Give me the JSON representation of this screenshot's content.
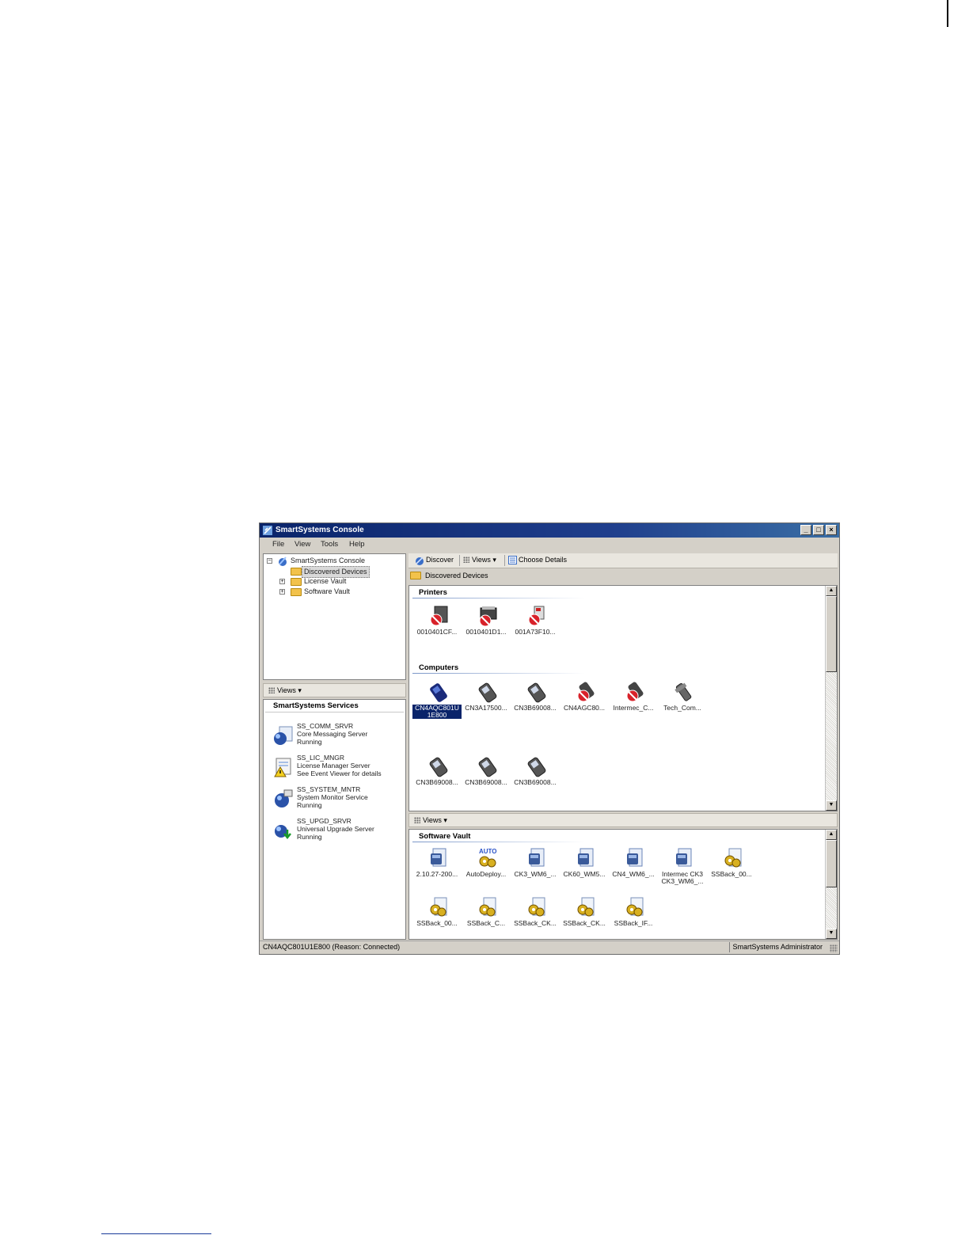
{
  "window": {
    "title": "SmartSystems Console",
    "minimize": "_",
    "maximize": "□",
    "close": "×"
  },
  "menu": {
    "file": "File",
    "view": "View",
    "tools": "Tools",
    "help": "Help"
  },
  "tree": {
    "root": "SmartSystems Console",
    "discovered": "Discovered Devices",
    "license": "License Vault",
    "software": "Software Vault"
  },
  "left_views": "Views",
  "services": {
    "header": "SmartSystems Services",
    "items": [
      {
        "name": "SS_COMM_SRVR",
        "desc": "Core Messaging Server",
        "status": "Running",
        "icon": "messaging-server-icon"
      },
      {
        "name": "SS_LIC_MNGR",
        "desc": "License Manager Server",
        "status": "See Event Viewer for details",
        "icon": "license-warning-icon"
      },
      {
        "name": "SS_SYSTEM_MNTR",
        "desc": "System Monitor Service",
        "status": "Running",
        "icon": "system-monitor-icon"
      },
      {
        "name": "SS_UPGD_SRVR",
        "desc": "Universal Upgrade Server",
        "status": "Running",
        "icon": "upgrade-server-icon"
      }
    ]
  },
  "toolbar": {
    "discover": "Discover",
    "views": "Views",
    "choose_details": "Choose Details"
  },
  "path": "Discovered Devices",
  "printers": {
    "title": "Printers",
    "items": [
      {
        "label": "0010401CF...",
        "icon": "printer-offline-icon"
      },
      {
        "label": "0010401D1...",
        "icon": "printer-offline-icon"
      },
      {
        "label": "001A73F10...",
        "icon": "printer-offline-icon"
      }
    ]
  },
  "computers": {
    "title": "Computers",
    "items": [
      {
        "label": "CN4AQC801U 1E800",
        "icon": "handheld-icon",
        "selected": true
      },
      {
        "label": "CN3A17500...",
        "icon": "handheld-icon"
      },
      {
        "label": "CN3B69008...",
        "icon": "handheld-icon"
      },
      {
        "label": "CN4AGC80...",
        "icon": "handheld-offline-icon"
      },
      {
        "label": "Intermec_C...",
        "icon": "handheld-offline-icon"
      },
      {
        "label": "Tech_Com...",
        "icon": "handheld-icon"
      },
      {
        "label": "CN3B69008...",
        "icon": "handheld-icon"
      },
      {
        "label": "CN3B69008...",
        "icon": "handheld-icon"
      },
      {
        "label": "CN3B69008...",
        "icon": "handheld-icon"
      }
    ]
  },
  "right_views": "Views",
  "vault": {
    "title": "Software Vault",
    "items": [
      {
        "label": "2.10.27-200...",
        "icon": "package-icon"
      },
      {
        "label": "AutoDeploy...",
        "icon": "auto-deploy-icon"
      },
      {
        "label": "CK3_WM6_...",
        "icon": "package-icon"
      },
      {
        "label": "CK60_WM5...",
        "icon": "package-icon"
      },
      {
        "label": "CN4_WM6_...",
        "icon": "package-icon"
      },
      {
        "label": "Intermec CK3 CK3_WM6_...",
        "icon": "package-icon"
      },
      {
        "label": "SSBack_00...",
        "icon": "settings-file-icon"
      },
      {
        "label": "SSBack_00...",
        "icon": "settings-file-icon"
      },
      {
        "label": "SSBack_C...",
        "icon": "settings-file-icon"
      },
      {
        "label": "SSBack_CK...",
        "icon": "settings-file-icon"
      },
      {
        "label": "SSBack_CK...",
        "icon": "settings-file-icon"
      },
      {
        "label": "SSBack_IF...",
        "icon": "settings-file-icon"
      }
    ]
  },
  "status": {
    "left": "CN4AQC801U1E800  (Reason: Connected)",
    "right": "SmartSystems Administrator"
  }
}
